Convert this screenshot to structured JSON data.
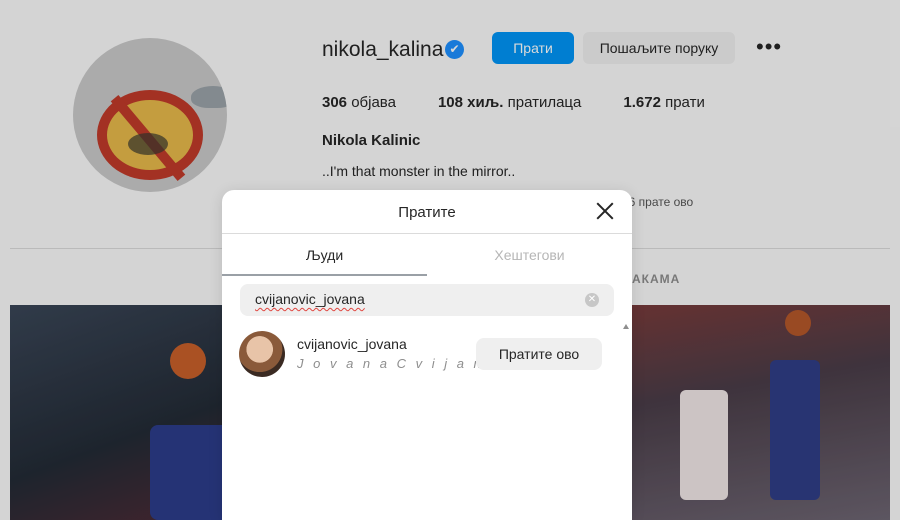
{
  "profile": {
    "username": "nikola_kalina",
    "verified_icon": "✔",
    "follow_label": "Прати",
    "message_label": "Пошаљите поруку",
    "more_label": "•••",
    "posts_count": "306",
    "posts_label": "објава",
    "followers_count": "108 хиљ.",
    "followers_label": "пратилаца",
    "following_count": "1.672",
    "following_label": "прати",
    "full_name": "Nikola Kalinic",
    "bio": "..I'm that monster in the mirror..",
    "followed_by_text": "16 прате ово",
    "tagged_tab_label": "АКАМА"
  },
  "modal": {
    "title": "Пратите",
    "tabs": [
      {
        "label": "Људи",
        "active": true
      },
      {
        "label": "Хештегови",
        "active": false
      }
    ],
    "search": {
      "value": "cvijanovic_jovana",
      "clear_icon": "✕"
    },
    "results": [
      {
        "username": "cvijanovic_jovana",
        "full_name": "J o v a n a C v i j a n o ...",
        "action_label": "Пратите ово"
      }
    ]
  },
  "colors": {
    "accent": "#0095f6",
    "verified": "#1e90ff",
    "button_bg": "#efefef"
  },
  "icons": {
    "close": "close-icon",
    "verified": "verified-badge-icon",
    "clear": "clear-search-icon",
    "more": "more-options-icon"
  }
}
